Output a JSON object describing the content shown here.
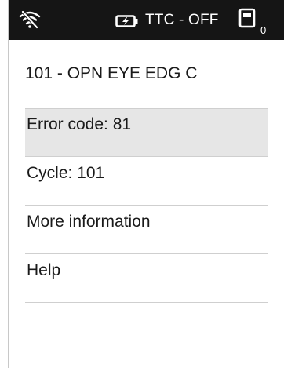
{
  "status_bar": {
    "icons": {
      "connection": "wifi-off-icon",
      "power": "battery-charging-icon",
      "device": "device-icon"
    },
    "ttc_text": "TTC - OFF",
    "device_count": "0"
  },
  "screen": {
    "title": "101 - OPN EYE EDG C",
    "menu": [
      {
        "label": "Error code: 81",
        "selected": true
      },
      {
        "label": "Cycle: 101",
        "selected": false
      },
      {
        "label": "More information",
        "selected": false
      },
      {
        "label": "Help",
        "selected": false
      }
    ]
  },
  "colors": {
    "status_bar_bg": "#151515",
    "selected_bg": "#e6e6e6",
    "divider": "#cfcfcf"
  }
}
